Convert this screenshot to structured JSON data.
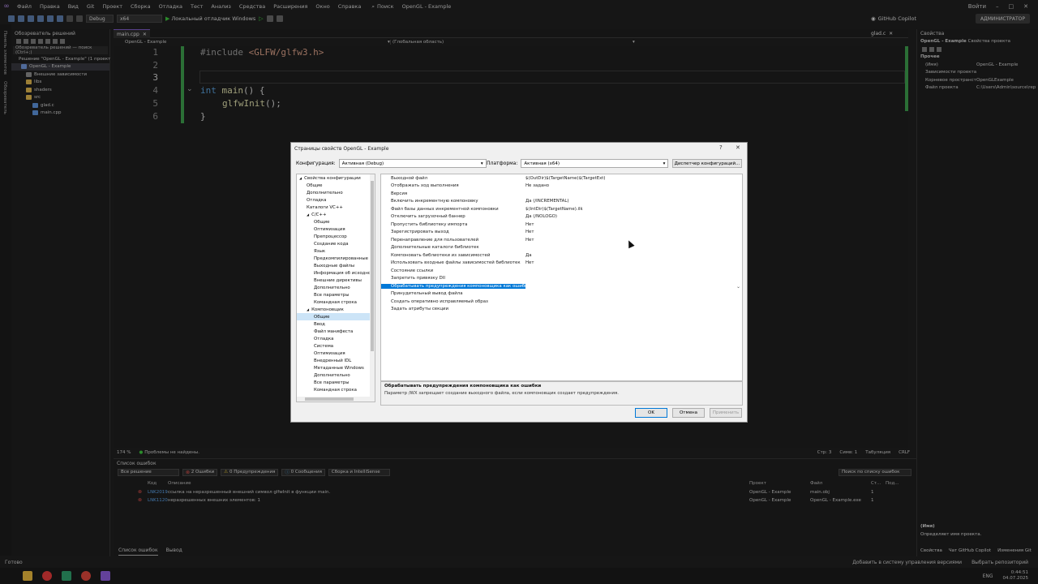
{
  "menu": {
    "items": [
      "Файл",
      "Правка",
      "Вид",
      "Git",
      "Проект",
      "Сборка",
      "Отладка",
      "Тест",
      "Анализ",
      "Средства",
      "Расширения",
      "Окно",
      "Справка"
    ],
    "search": "Поиск",
    "title": "OpenGL - Example",
    "signin": "Войти"
  },
  "toolbar": {
    "config": "Debug",
    "platform": "x64",
    "run_label": "Локальный отладчик Windows",
    "copilot": "GitHub Copilot",
    "admin": "АДМИНИСТРАТОР"
  },
  "side_strip": [
    "Панель элементов",
    "Обозреватель"
  ],
  "solution": {
    "title": "Обозреватель решений",
    "search": "Обозреватель решений — поиск (Ctrl+;)",
    "solution_label": "Решение \"OpenGL - Example\" (1 проект",
    "project": "OpenGL - Example",
    "items": [
      {
        "label": "Внешние зависимости",
        "indent": 2
      },
      {
        "label": "libs",
        "indent": 2
      },
      {
        "label": "shaders",
        "indent": 2
      },
      {
        "label": "src",
        "indent": 2
      },
      {
        "label": "glad.c",
        "indent": 3
      },
      {
        "label": "main.cpp",
        "indent": 3
      }
    ]
  },
  "editor": {
    "tab_main": "main.cpp",
    "tab_glad": "glad.c",
    "nav_project": "OpenGL - Example",
    "nav_scope": "(Глобальная область)",
    "lines": [
      "1",
      "2",
      "3",
      "4",
      "5",
      "6"
    ],
    "code": {
      "l1_pp": "#include ",
      "l1_inc": "<GLFW/glfw3.h>",
      "l4_kw": "int ",
      "l4_fn": "main",
      "l4_rest": "() {",
      "l5_fn": "glfwInit",
      "l5_rest": "();",
      "l6": "}"
    },
    "status": {
      "zoom": "174 %",
      "problems": "Проблемы не найдены.",
      "line": "Стр: 3",
      "col": "Симв: 1",
      "tabs": "Табуляция",
      "eol": "CRLF"
    }
  },
  "errors": {
    "title": "Список ошибок",
    "scope": "Все решение",
    "errors_btn": "2 Ошибки",
    "warnings_btn": "0 Предупреждения",
    "messages_btn": "0 Сообщения",
    "build_filter": "Сборка и IntelliSense",
    "search": "Поиск по списку ошибок",
    "headers": {
      "code": "Код",
      "desc": "Описание",
      "project": "Проект",
      "file": "Файл",
      "line": "Ст...",
      "suppr": "Под..."
    },
    "rows": [
      {
        "code": "LNK2019",
        "desc": "ссылка на неразрешенный внешний символ glfwInit в функции main.",
        "project": "OpenGL - Example",
        "file": "main.obj",
        "line": "1"
      },
      {
        "code": "LNK1120",
        "desc": "неразрешенных внешних элементов: 1",
        "project": "OpenGL - Example",
        "file": "OpenGL - Example.exe",
        "line": "1"
      }
    ],
    "bottom_tabs": [
      "Список ошибок",
      "Вывод"
    ]
  },
  "properties": {
    "title": "Свойства",
    "object": "OpenGL - Example",
    "object_type": "Свойства проекта",
    "category": "Прочее",
    "rows": [
      {
        "k": "(Имя)",
        "v": "OpenGL - Example"
      },
      {
        "k": "Зависимости проекта",
        "v": ""
      },
      {
        "k": "Корневое пространст",
        "v": "OpenGLExample"
      },
      {
        "k": "Файл проекта",
        "v": "C:\\Users\\Admin\\source\\rep"
      }
    ],
    "desc_title": "(Имя)",
    "desc_text": "Определяет имя проекта.",
    "bottom_tabs": [
      "Свойства",
      "Чат GitHub Copilot",
      "Изменения Git"
    ]
  },
  "statusbar": {
    "ready": "Готово",
    "add_vcs": "Добавить в систему управления версиями",
    "repo": "Выбрать репозиторий"
  },
  "taskbar": {
    "lang": "ENG",
    "time": "0:44:51",
    "date": "04.07.2025"
  },
  "dialog": {
    "title": "Страницы свойств OpenGL - Example",
    "config_label": "Конфигурация:",
    "config_value": "Активная (Debug)",
    "platform_label": "Платформа:",
    "platform_value": "Активная (x64)",
    "config_manager": "Диспетчер конфигураций...",
    "tree": [
      {
        "label": "Свойства конфигурации",
        "indent": 0,
        "exp": "◢"
      },
      {
        "label": "Общие",
        "indent": 1
      },
      {
        "label": "Дополнительно",
        "indent": 1
      },
      {
        "label": "Отладка",
        "indent": 1
      },
      {
        "label": "Каталоги VC++",
        "indent": 1
      },
      {
        "label": "C/C++",
        "indent": 1,
        "exp": "◢"
      },
      {
        "label": "Общие",
        "indent": 2
      },
      {
        "label": "Оптимизация",
        "indent": 2
      },
      {
        "label": "Препроцессор",
        "indent": 2
      },
      {
        "label": "Создание кода",
        "indent": 2
      },
      {
        "label": "Язык",
        "indent": 2
      },
      {
        "label": "Предкомпилированные заголовки",
        "indent": 2
      },
      {
        "label": "Выходные файлы",
        "indent": 2
      },
      {
        "label": "Информация об исходном коде",
        "indent": 2
      },
      {
        "label": "Внешние директивы",
        "indent": 2
      },
      {
        "label": "Дополнительно",
        "indent": 2
      },
      {
        "label": "Все параметры",
        "indent": 2
      },
      {
        "label": "Командная строка",
        "indent": 2
      },
      {
        "label": "Компоновщик",
        "indent": 1,
        "exp": "◢"
      },
      {
        "label": "Общие",
        "indent": 2,
        "sel": true
      },
      {
        "label": "Ввод",
        "indent": 2
      },
      {
        "label": "Файл манифеста",
        "indent": 2
      },
      {
        "label": "Отладка",
        "indent": 2
      },
      {
        "label": "Система",
        "indent": 2
      },
      {
        "label": "Оптимизация",
        "indent": 2
      },
      {
        "label": "Внедренный IDL",
        "indent": 2
      },
      {
        "label": "Метаданные Windows",
        "indent": 2
      },
      {
        "label": "Дополнительно",
        "indent": 2
      },
      {
        "label": "Все параметры",
        "indent": 2
      },
      {
        "label": "Командная строка",
        "indent": 2
      }
    ],
    "props": [
      {
        "n": "Выходной файл",
        "v": "$(OutDir)$(TargetName)$(TargetExt)"
      },
      {
        "n": "Отображать ход выполнения",
        "v": "Не задано"
      },
      {
        "n": "Версия",
        "v": ""
      },
      {
        "n": "Включить инкрементную компоновку",
        "v": "Да (/INCREMENTAL)"
      },
      {
        "n": "Файл базы данных инкрементной компоновки",
        "v": "$(IntDir)$(TargetName).ilk"
      },
      {
        "n": "Отключить загрузочный баннер",
        "v": "Да (/NOLOGO)"
      },
      {
        "n": "Пропустить библиотеку импорта",
        "v": "Нет"
      },
      {
        "n": "Зарегистрировать выход",
        "v": "Нет"
      },
      {
        "n": "Перенаправление для пользователей",
        "v": "Нет"
      },
      {
        "n": "Дополнительные каталоги библиотек",
        "v": ""
      },
      {
        "n": "Компоновать библиотеки из зависимостей",
        "v": "Да"
      },
      {
        "n": "Использовать входные файлы зависимостей библиотек",
        "v": "Нет"
      },
      {
        "n": "Состояние ссылки",
        "v": ""
      },
      {
        "n": "Запретить привязку DII",
        "v": ""
      },
      {
        "n": "Обрабатывать предупреждения компоновщика как ошибки",
        "v": "",
        "sel": true
      },
      {
        "n": "Принудительный вывод файла",
        "v": ""
      },
      {
        "n": "Создать оперативно исправляемый образ",
        "v": ""
      },
      {
        "n": "Задать атрибуты секции",
        "v": ""
      }
    ],
    "desc_title": "Обрабатывать предупреждения компоновщика как ошибки",
    "desc_text": "Параметр /WX запрещает создание выходного файла, если компоновщик создает предупреждения.",
    "ok": "OK",
    "cancel": "Отмена",
    "apply": "Применить"
  }
}
